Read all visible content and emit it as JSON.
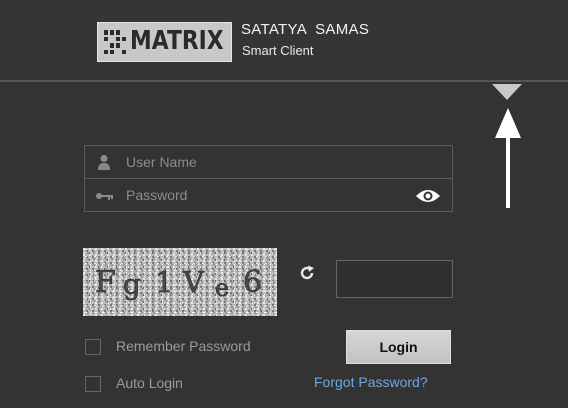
{
  "header": {
    "logo_text": "MATRIX",
    "brand_title": "SATATYA  SAMAS",
    "brand_subtitle": "Smart Client"
  },
  "form": {
    "username": {
      "placeholder": "User Name",
      "value": "",
      "icon": "user-icon"
    },
    "password": {
      "placeholder": "Password",
      "value": "",
      "icon": "key-icon",
      "toggle_icon": "eye-icon"
    },
    "captcha": {
      "text": "Fg1Ve6",
      "refresh_icon": "refresh-icon",
      "input_value": ""
    },
    "remember_password": {
      "label": "Remember Password",
      "checked": false
    },
    "auto_login": {
      "label": "Auto Login",
      "checked": false
    },
    "login_label": "Login",
    "forgot_label": "Forgot Password?"
  },
  "menu_toggle_icon": "triangle-down-icon",
  "annotation_icon": "up-arrow-icon",
  "colors": {
    "background": "#333333",
    "link": "#6fa8dc",
    "button": "#cccccc"
  }
}
